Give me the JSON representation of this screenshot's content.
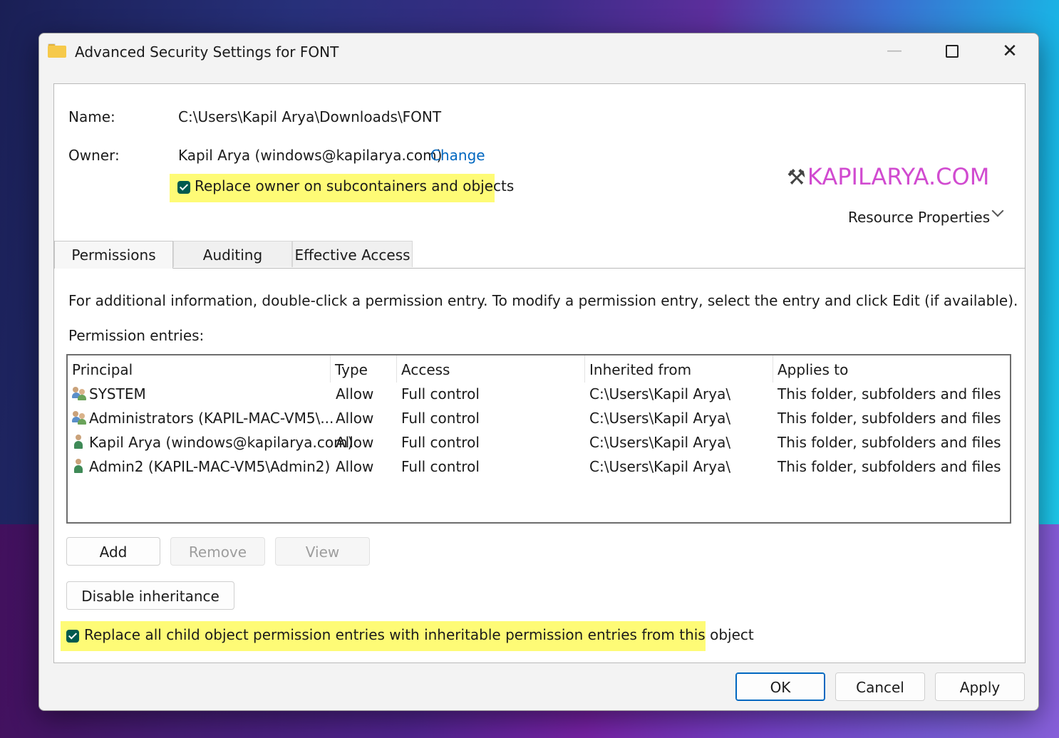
{
  "window": {
    "title": "Advanced Security Settings for FONT",
    "min_label": "—",
    "close_label": "✕"
  },
  "info": {
    "name_label": "Name:",
    "name_value": "C:\\Users\\Kapil Arya\\Downloads\\FONT",
    "owner_label": "Owner:",
    "owner_value": "Kapil Arya (windows@kapilarya.com)",
    "change_link": "Change",
    "replace_owner_label": "Replace owner on subcontainers and objects",
    "replace_owner_checked": true
  },
  "brand": {
    "text": "KAPILARYA.COM"
  },
  "resource_properties": "Resource Properties",
  "tabs": [
    {
      "label": "Permissions",
      "active": true
    },
    {
      "label": "Auditing",
      "active": false
    },
    {
      "label": "Effective Access",
      "active": false
    }
  ],
  "permissions": {
    "info_text": "For additional information, double-click a permission entry. To modify a permission entry, select the entry and click Edit (if available).",
    "entries_label": "Permission entries:",
    "columns": [
      "Principal",
      "Type",
      "Access",
      "Inherited from",
      "Applies to"
    ],
    "rows": [
      {
        "icon": "group-icon",
        "principal": "SYSTEM",
        "type": "Allow",
        "access": "Full control",
        "inherited": "C:\\Users\\Kapil Arya\\",
        "applies": "This folder, subfolders and files"
      },
      {
        "icon": "group-icon",
        "principal": "Administrators (KAPIL-MAC-VM5\\...",
        "type": "Allow",
        "access": "Full control",
        "inherited": "C:\\Users\\Kapil Arya\\",
        "applies": "This folder, subfolders and files"
      },
      {
        "icon": "user-icon",
        "principal": "Kapil Arya (windows@kapilarya.com)",
        "type": "Allow",
        "access": "Full control",
        "inherited": "C:\\Users\\Kapil Arya\\",
        "applies": "This folder, subfolders and files"
      },
      {
        "icon": "user-icon",
        "principal": "Admin2 (KAPIL-MAC-VM5\\Admin2)",
        "type": "Allow",
        "access": "Full control",
        "inherited": "C:\\Users\\Kapil Arya\\",
        "applies": "This folder, subfolders and files"
      }
    ]
  },
  "buttons": {
    "add": "Add",
    "remove": "Remove",
    "view": "View",
    "disable_inheritance": "Disable inheritance",
    "ok": "OK",
    "cancel": "Cancel",
    "apply": "Apply"
  },
  "replace_child": {
    "label": "Replace all child object permission entries with inheritable permission entries from this object",
    "checked": true
  },
  "colors": {
    "accent": "#0067c0",
    "checkbox": "#005a4e",
    "highlight": "#fefb76",
    "brand": "#d14bd0"
  }
}
